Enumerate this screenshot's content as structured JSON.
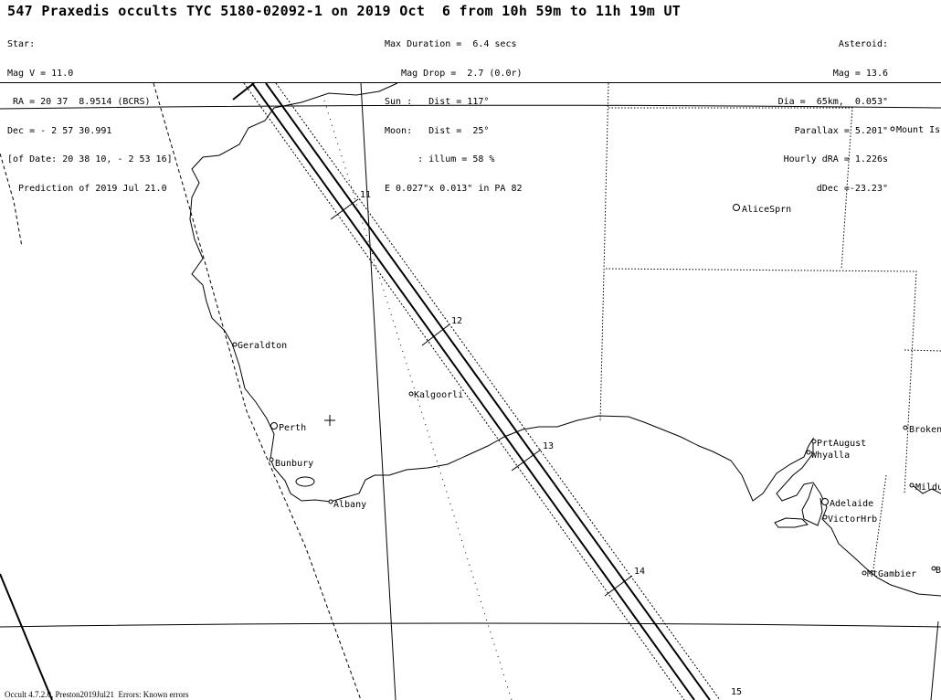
{
  "header": {
    "title": "547 Praxedis occults TYC 5180-02092-1 on 2019 Oct  6 from 10h 59m to 11h 19m UT",
    "star_lines": [
      "Star:",
      "Mag V = 11.0",
      " RA = 20 37  8.9514 (BCRS)",
      "Dec = - 2 57 30.991",
      "[of Date: 20 38 10, - 2 53 16]",
      "  Prediction of 2019 Jul 21.0"
    ],
    "event_lines": [
      "Max Duration =  6.4 secs",
      "   Mag Drop =  2.7 (0.0r)",
      "Sun :   Dist = 117°",
      "Moon:   Dist =  25°",
      "      : illum = 58 %",
      "E 0.027\"x 0.013\" in PA 82"
    ],
    "asteroid_lines": [
      "Asteroid:",
      "Mag = 13.6",
      "Dia =  65km,  0.053\"",
      "Parallax = 5.201\"",
      "Hourly dRA = 1.226s",
      "dDec =-23.23\""
    ]
  },
  "map": {
    "path_time_labels": [
      "11",
      "12",
      "13",
      "14",
      "15"
    ],
    "cities": [
      {
        "name": "Mount Is"
      },
      {
        "name": "AliceSprn"
      },
      {
        "name": "Geraldton"
      },
      {
        "name": "Kalgoorli"
      },
      {
        "name": "Perth"
      },
      {
        "name": "Bunbury"
      },
      {
        "name": "Albany"
      },
      {
        "name": "PrtAugust"
      },
      {
        "name": "Whyalla"
      },
      {
        "name": "Broken"
      },
      {
        "name": "Mildu"
      },
      {
        "name": "Adelaide"
      },
      {
        "name": "VictorHrb"
      },
      {
        "name": "MtGambier"
      },
      {
        "name": "B"
      }
    ],
    "colors": {
      "ink": "#000000",
      "background": "#ffffff"
    }
  },
  "footer": {
    "text": "Occult 4.7.2.0, Preston2019Jul21  Errors: Known errors"
  }
}
